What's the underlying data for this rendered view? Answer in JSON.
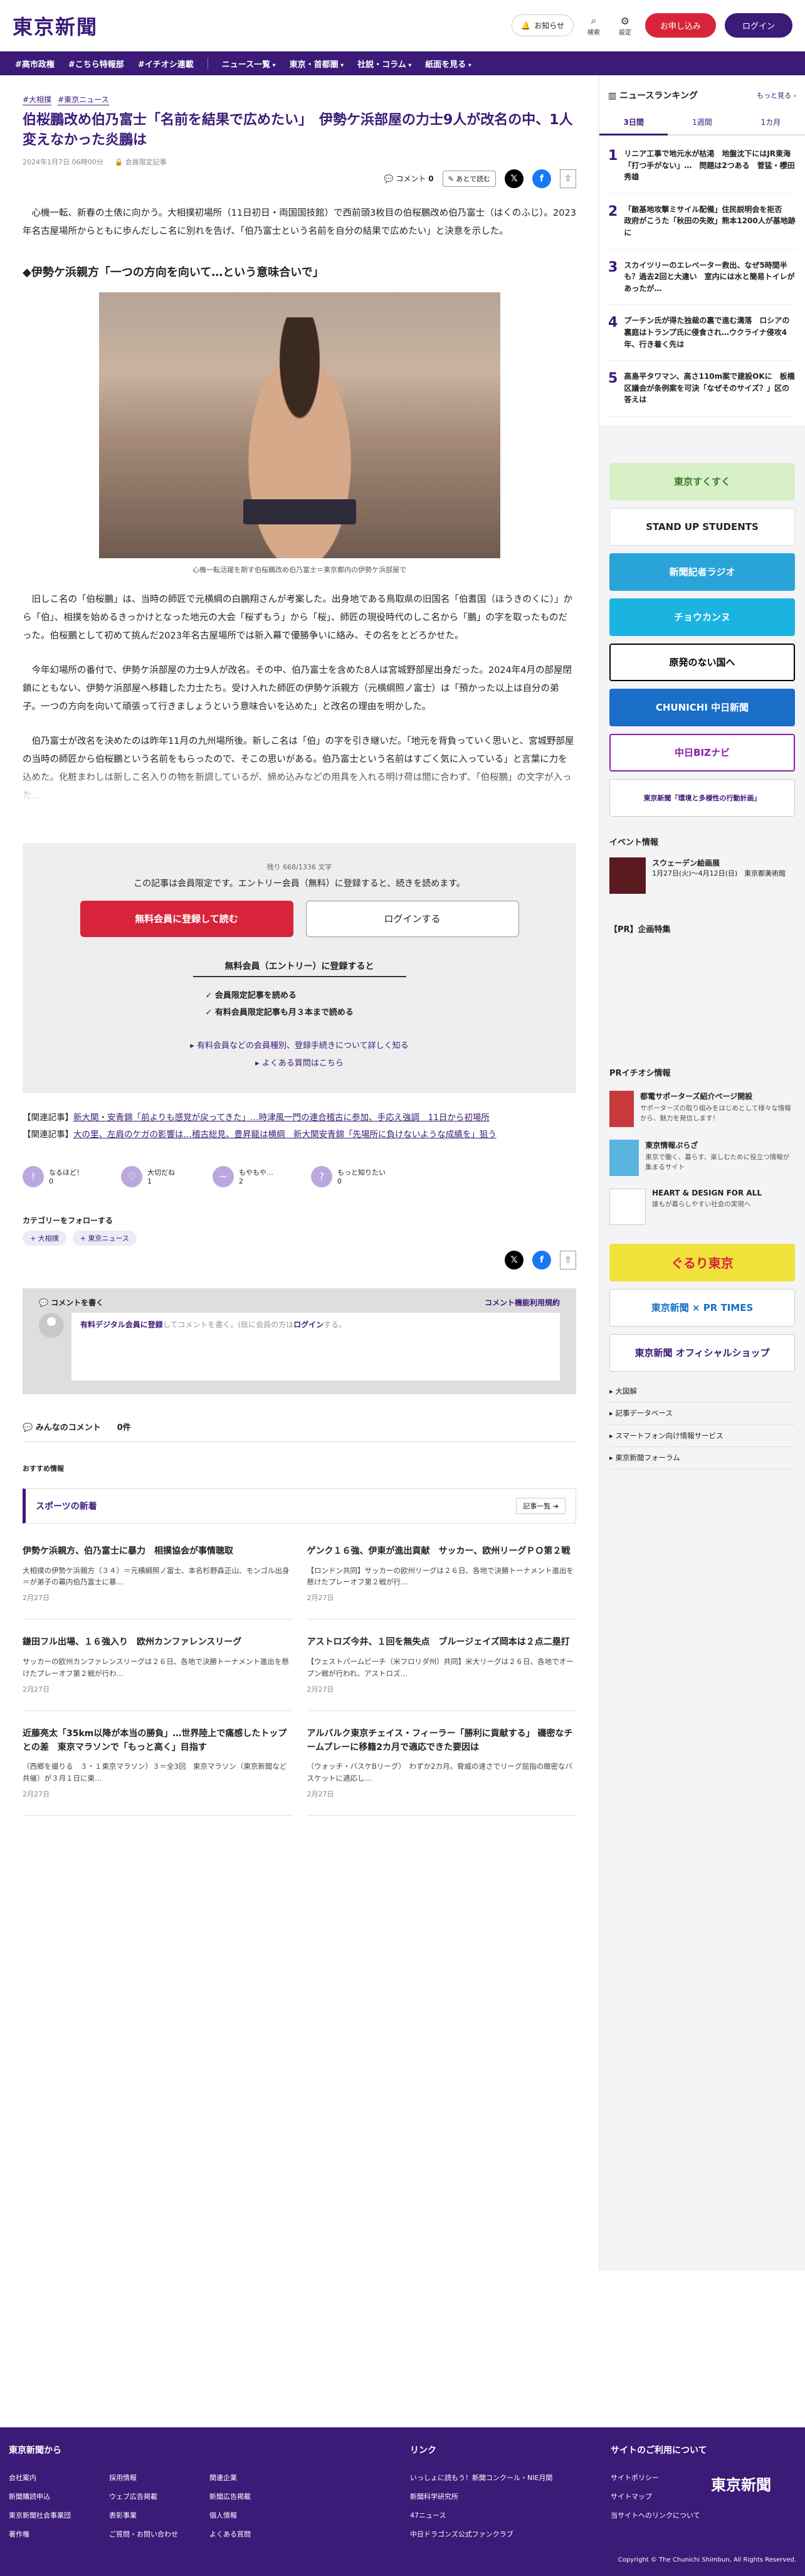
{
  "header": {
    "logo": "東京新聞",
    "notice": "お知らせ",
    "search": "検索",
    "settings": "設定",
    "apply": "お申し込み",
    "login": "ログイン"
  },
  "nav": {
    "tags": [
      "#高市政権",
      "#こちら特報部",
      "#イチオシ連載"
    ],
    "menus": [
      "ニュース一覧",
      "東京・首都圏",
      "社説・コラム",
      "紙面を見る"
    ]
  },
  "article": {
    "tags": [
      "#大相撲",
      "#東京ニュース"
    ],
    "headline": "伯桜鵬改め伯乃富士「名前を結果で広めたい」　伊勢ケ浜部屋の力士9人が改名の中、1人変えなかった炎鵬は",
    "date": "2024年1月7日 06時00分",
    "members_only": "会員限定記事",
    "comment_label": "コメント",
    "comment_count": "0",
    "read_later": "あとで読む",
    "p1": "心機一転、新春の土俵に向かう。大相撲初場所（11日初日・両国国技館）で西前頭3枚目の伯桜鵬改め伯乃富士（はくのふじ）。2023年名古屋場所からともに歩んだしこ名に別れを告げ、「伯乃富士という名前を自分の結果で広めたい」と決意を示した。",
    "subhead": "◆伊勢ケ浜親方「一つの方向を向いて…という意味合いで」",
    "caption": "心機一転活躍を期す伯桜鵬改め伯乃富士＝東京都内の伊勢ケ浜部屋で",
    "p2": "旧しこ名の「伯桜鵬」は、当時の師匠で元横綱の白鵬翔さんが考案した。出身地である鳥取県の旧国名「伯耆国（ほうきのくに）」から「伯」、相撲を始めるきっかけとなった地元の大会「桜ずもう」から「桜」、師匠の現役時代のしこ名から「鵬」の字を取ったものだった。伯桜鵬として初めて挑んだ2023年名古屋場所では新入幕で優勝争いに絡み、その名をとどろかせた。",
    "p3": "今年幻場所の番付で、伊勢ケ浜部屋の力士9人が改名。その中、伯乃富士を含めた8人は宮城野部屋出身だった。2024年4月の部屋閉鎖にともない、伊勢ケ浜部屋へ移籍した力士たち。受け入れた師匠の伊勢ケ浜親方（元横綱照ノ富士）は「預かった以上は自分の弟子。一つの方向を向いて頑張って行きましょうという意味合いを込めた」と改名の理由を明かした。",
    "p4": "伯乃富士が改名を決めたのは昨年11月の九州場所後。新しこ名は「伯」の字を引き継いだ。「地元を背負っていく思いと、宮城野部屋の当時の師匠から伯桜鵬という名前をもらったので、そこの思いがある。伯乃富士という名前はすごく気に入っている」と言葉に力を込めた。化粧まわしは新しこ名入りの物を新調しているが、締め込みなどの用具を入れる明け荷は間に合わず、「伯桜鵬」の文字が入った…"
  },
  "paywall": {
    "count": "残り 668/1336 文字",
    "message": "この記事は会員限定です。エントリー会員（無料）に登録すると、続きを読めます。",
    "register": "無料会員に登録して読む",
    "login": "ログインする",
    "benefit_title": "無料会員（エントリー）に登録すると",
    "benefits": [
      "会員限定記事を読める",
      "有料会員限定記事も月３本まで読める"
    ],
    "links": [
      "有料会員などの会員種別、登録手続きについて詳しく知る",
      "よくある質問はこちら"
    ]
  },
  "related": [
    {
      "label": "【関連記事】",
      "text": "新大関・安青錦「前よりも感覚が戻ってきた」…時津風一門の連合稽古に参加、手応え強調　11日から初場所"
    },
    {
      "label": "【関連記事】",
      "text": "大の里、左肩のケガの影響は…稽古総見、豊昇龍は横綱　新大関安青錦「先場所に負けないような成績を」狙う"
    }
  ],
  "reactions": [
    {
      "label": "なるほど！",
      "count": "0",
      "icon": "!"
    },
    {
      "label": "大切だね",
      "count": "1",
      "icon": "♡"
    },
    {
      "label": "もやもや…",
      "count": "2",
      "icon": "~"
    },
    {
      "label": "もっと知りたい",
      "count": "0",
      "icon": "?"
    }
  ],
  "follow": {
    "title": "カテゴリーをフォローする",
    "cats": [
      "大相撲",
      "東京ニュース"
    ]
  },
  "comment": {
    "title": "コメントを書く",
    "rules": "コメント機能利用規約",
    "prompt_a": "有料デジタル会員に登録",
    "prompt_b": "してコメントを書く。(既に会員の方は",
    "prompt_c": "ログイン",
    "prompt_d": "する。",
    "all": "みんなのコメント　　0件"
  },
  "recommend": {
    "label": "おすすめ情報",
    "section": "スポーツの新着",
    "more": "記事一覧",
    "news": [
      {
        "h": "伊勢ケ浜親方、伯乃富士に暴力　相撲協会が事情聴取",
        "b": "大相撲の伊勢ケ浜親方（３４）＝元横綱照ノ富士、本名杉野森正山、モンゴル出身＝が弟子の幕内伯乃富士に暴…",
        "d": "2月27日"
      },
      {
        "h": "ゲンク１６強、伊東が進出貢献　サッカー、欧州リーグＰＯ第２戦",
        "b": "【ロンドン共同】サッカーの欧州リーグは２６日、各地で決勝トーナメント進出を懸けたプレーオフ第２戦が行…",
        "d": "2月27日"
      },
      {
        "h": "鎌田フル出場、１６強入り　欧州カンファレンスリーグ",
        "b": "サッカーの欧州カンファレンスリーグは２６日、各地で決勝トーナメント進出を懸けたプレーオフ第２戦が行わ…",
        "d": "2月27日"
      },
      {
        "h": "アストロズ今井、１回を無失点　ブルージェイズ岡本は２点二塁打",
        "b": "【ウェストパームビーチ（米フロリダ州）共同】米大リーグは２６日、各地でオープン戦が行われ、アストロズ…",
        "d": "2月27日"
      },
      {
        "h": "近藤亮太「35km以降が本当の勝負」…世界陸上で痛感したトップとの差　東京マラソンで「もっと高く」目指す",
        "b": "（西郷を撮りる　３・１東京マラソン）３＝全3回　東京マラソン（東京新聞など共催）が３月１日に東…",
        "d": "2月27日"
      },
      {
        "h": "アルバルク東京チェイス・フィーラー「勝利に貢献する」 磯密なチームプレーに移籍2カ月で適応できた要因は",
        "b": "（ウォッチ・バスケBリーグ）　わずか2カ月。脅威の速さでリーグ屈指の緻密なバスケットに適応し…",
        "d": "2月27日"
      }
    ]
  },
  "ranking": {
    "title": "ニュースランキング",
    "more": "もっと見る",
    "tabs": [
      "3日間",
      "1週間",
      "1カ月"
    ],
    "items": [
      "リニア工事で地元水が枯渇　地盤沈下にはJR東海「打つ手がない」…　問題は2つある　菅猛・櫻田秀雄",
      "「敵基地攻撃ミサイル配備」住民説明会を拒否　政府がこうた「秋田の失敗」熊本1200人が基地跡に",
      "スカイツリーのエレベーター救出、なぜ5時間半も？過去2回と大違い　室内には水と簡易トイレがあったが…",
      "プーチン氏が得た独裁の裏で進む溝落　ロシアの裏庭はトランプ氏に侵食され…ウクライナ侵攻4年、行き着く先は",
      "高島平タワマン、高さ110m案で建設OKに　板橋区議会が条例案を可決「なぜそのサイズ？」区の答えは"
    ]
  },
  "side": {
    "event_title": "イベント情報",
    "event": {
      "t": "スウェーデン絵画展",
      "b": "1月27日(火)～4月12日(日)　東京都美術館"
    },
    "pr_title": "【PR】企画特集",
    "pr_ichioshi": "PRイチオシ情報",
    "pr_items": [
      {
        "t": "都電サポーターズ紹介ページ開設",
        "b": "サポーターズの取り組みをはじめとして様々な情報から、魅力を発信します！"
      },
      {
        "t": "東京情報ぷらざ",
        "b": "東京で働く、暮らす、楽しむために役立つ情報が集まるサイト"
      },
      {
        "t": "HEART & DESIGN FOR ALL",
        "b": "誰もが暮らしやすい社会の実現へ"
      }
    ],
    "banners": [
      "東京すくすく",
      "STAND UP STUDENTS",
      "新聞記者ラジオ",
      "チョウカンヌ",
      "原発のない国へ",
      "CHUNICHI 中日新聞",
      "中日BIZナビ",
      "東京新聞「環境と多様性の行動計画」",
      "ぐるり東京",
      "東京新聞 × PR TIMES",
      "東京新聞 オフィシャルショップ"
    ],
    "links": [
      "大図解",
      "記事データベース",
      "スマートフォン向け情報サービス",
      "東京新聞フォーラム"
    ]
  },
  "footer": {
    "col1_title": "東京新聞から",
    "col1": [
      "会社案内",
      "採用情報",
      "関連企業",
      "新聞購読申込",
      "ウェブ広告掲載",
      "新聞広告掲載",
      "東京新聞社会事業団",
      "表彰事業",
      "個人情報",
      "著作権",
      "ご質問・お問い合わせ",
      "よくある質問"
    ],
    "col2_title": "リンク",
    "col2": [
      "いっしょに読もう！新聞コンクール・NIE月間",
      "新聞科学研究所",
      "47ニュース",
      "中日ドラゴンズ公式ファンクラブ"
    ],
    "col3_title": "サイトのご利用について",
    "col3": [
      "サイトポリシー",
      "サイトマップ",
      "当サイトへのリンクについて"
    ],
    "logo": "東京新聞",
    "copyright": "Copyright © The Chunichi Shimbun, All Rights Reserved."
  }
}
